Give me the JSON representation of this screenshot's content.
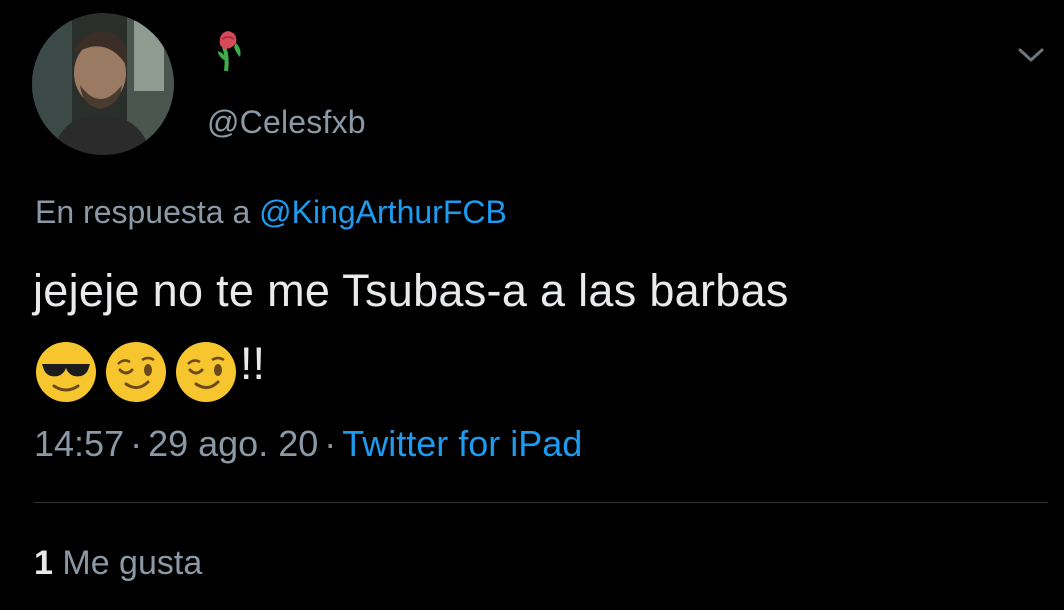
{
  "user": {
    "handle": "@Celesfxb",
    "display_name_icon": "wilted-rose-icon",
    "avatar": "avatar"
  },
  "tweet": {
    "reply_prefix": "En respuesta a",
    "reply_to": "@KingArthurFCB",
    "text": "jejeje no te me Tsubas-a a las barbas",
    "emojis": [
      "sunglasses-face-icon",
      "winking-face-icon",
      "winking-face-icon"
    ],
    "exclamations": "!!",
    "time": "14:57",
    "date": "29 ago. 20",
    "source": "Twitter for iPad",
    "separator": "·"
  },
  "stats": {
    "likes_count": "1",
    "likes_label": "Me gusta"
  },
  "menu": {
    "icon": "chevron-down-icon"
  },
  "colors": {
    "background": "#000000",
    "text": "#e8eaec",
    "secondary": "#8b98a5",
    "link": "#1d9bf0",
    "divider": "#2f3336"
  }
}
